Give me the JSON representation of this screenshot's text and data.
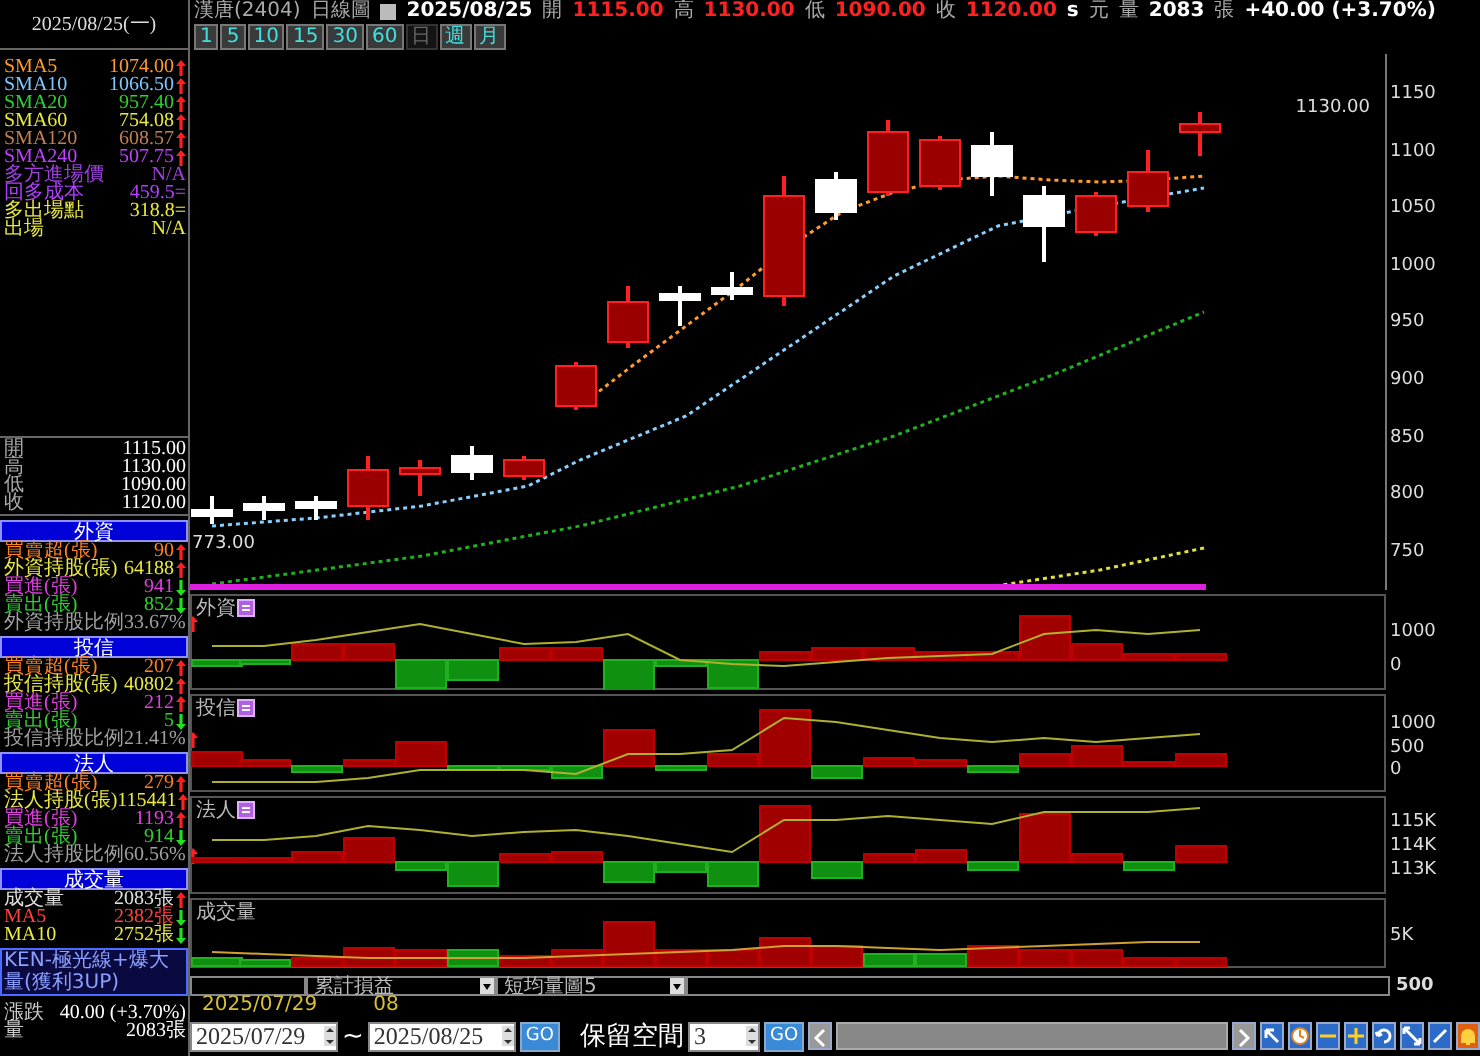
{
  "header": {
    "items": [
      {
        "text": "漢唐(2404)",
        "kind": "label"
      },
      {
        "text": "日線圖",
        "kind": "label"
      },
      {
        "text": "2025/08/25",
        "kind": "bold"
      },
      {
        "text": "開",
        "kind": "label"
      },
      {
        "text": "1115.00",
        "kind": "price"
      },
      {
        "text": "高",
        "kind": "label"
      },
      {
        "text": "1130.00",
        "kind": "price"
      },
      {
        "text": "低",
        "kind": "label"
      },
      {
        "text": "1090.00",
        "kind": "price"
      },
      {
        "text": "收",
        "kind": "label"
      },
      {
        "text": "1120.00",
        "kind": "price"
      },
      {
        "text": "s",
        "kind": "bold"
      },
      {
        "text": "元",
        "kind": "label"
      },
      {
        "text": "量",
        "kind": "label"
      },
      {
        "text": "2083",
        "kind": "bold"
      },
      {
        "text": "張",
        "kind": "label"
      },
      {
        "text": "+40.00 (+3.70%)",
        "kind": "bold"
      }
    ]
  },
  "timeframes": [
    {
      "label": "1",
      "selected": false
    },
    {
      "label": "5",
      "selected": false
    },
    {
      "label": "10",
      "selected": false
    },
    {
      "label": "15",
      "selected": false
    },
    {
      "label": "30",
      "selected": false
    },
    {
      "label": "60",
      "selected": false
    },
    {
      "label": "日",
      "selected": true
    },
    {
      "label": "週",
      "selected": false
    },
    {
      "label": "月",
      "selected": false
    }
  ],
  "sidebar": {
    "date": "2025/08/25(一)",
    "indicators": [
      {
        "label": "SMA5",
        "value": "1074.00",
        "color": "#ff9a30",
        "kind": "up"
      },
      {
        "label": "SMA10",
        "value": "1066.50",
        "color": "#7ec8ff",
        "kind": "up"
      },
      {
        "label": "SMA20",
        "value": "957.40",
        "color": "#30d030",
        "kind": "up"
      },
      {
        "label": "SMA60",
        "value": "754.08",
        "color": "#e8e840",
        "kind": "up"
      },
      {
        "label": "SMA120",
        "value": "608.57",
        "color": "#c08050",
        "kind": "up"
      },
      {
        "label": "SMA240",
        "value": "507.75",
        "color": "#c040ff",
        "kind": "up"
      },
      {
        "label": "多方進場價",
        "value": "N/A",
        "color": "#a040e0",
        "kind": "plain"
      },
      {
        "label": "回多成本",
        "value": "459.5=",
        "color": "#b040ff",
        "kind": "plain"
      },
      {
        "label": "多出場點",
        "value": "318.8=",
        "color": "#e8e840",
        "kind": "plain"
      },
      {
        "label": "出場",
        "value": "N/A",
        "color": "#e8e840",
        "kind": "plain"
      }
    ],
    "ohlc": [
      {
        "label": "開",
        "value": "1115.00"
      },
      {
        "label": "高",
        "value": "1130.00"
      },
      {
        "label": "低",
        "value": "1090.00"
      },
      {
        "label": "收",
        "value": "1120.00"
      }
    ],
    "sections": [
      {
        "title": "外資",
        "rows": [
          {
            "label": "買賣超(張)",
            "value": "90",
            "color": "#ff8020",
            "kind": "up"
          },
          {
            "label": "外資持股(張)",
            "value": "64188",
            "color": "#e8e840",
            "kind": "up"
          },
          {
            "label": "買進(張)",
            "value": "941",
            "color": "#e040e0",
            "kind": "down"
          },
          {
            "label": "賣出(張)",
            "value": "852",
            "color": "#30d030",
            "kind": "down"
          },
          {
            "label": "外資持股比例",
            "value": "33.67%",
            "color": "#a0a0a0",
            "kind": "up"
          }
        ]
      },
      {
        "title": "投信",
        "rows": [
          {
            "label": "買賣超(張)",
            "value": "207",
            "color": "#ff8020",
            "kind": "up"
          },
          {
            "label": "投信持股(張)",
            "value": "40802",
            "color": "#e8e840",
            "kind": "up"
          },
          {
            "label": "買進(張)",
            "value": "212",
            "color": "#e040e0",
            "kind": "up"
          },
          {
            "label": "賣出(張)",
            "value": "5",
            "color": "#30d030",
            "kind": "down"
          },
          {
            "label": "投信持股比例",
            "value": "21.41%",
            "color": "#a0a0a0",
            "kind": "up"
          }
        ]
      },
      {
        "title": "法人",
        "rows": [
          {
            "label": "買賣超(張)",
            "value": "279",
            "color": "#ff8020",
            "kind": "up"
          },
          {
            "label": "法人持股(張)",
            "value": "115441",
            "color": "#e8e840",
            "kind": "up"
          },
          {
            "label": "買進(張)",
            "value": "1193",
            "color": "#e040e0",
            "kind": "up"
          },
          {
            "label": "賣出(張)",
            "value": "914",
            "color": "#30d030",
            "kind": "down"
          },
          {
            "label": "法人持股比例",
            "value": "60.56%",
            "color": "#a0a0a0",
            "kind": "up"
          }
        ]
      },
      {
        "title": "成交量",
        "rows": [
          {
            "label": "成交量",
            "value": "2083張",
            "color": "#e0e0e0",
            "kind": "up"
          },
          {
            "label": "MA5",
            "value": "2382張",
            "color": "#ff4040",
            "kind": "down"
          },
          {
            "label": "MA10",
            "value": "2752張",
            "color": "#e8e840",
            "kind": "down"
          }
        ]
      }
    ],
    "strategy": "KEN-極光線+爆大量(獲利3UP)",
    "summary": [
      {
        "label": "漲跌",
        "value": "40.00 (+3.70%)"
      },
      {
        "label": "量",
        "value": "2083張"
      }
    ]
  },
  "main_chart": {
    "high_label": "1130.00",
    "low_label": "773.00",
    "yticks": [
      "1150",
      "1100",
      "1050",
      "1000",
      "950",
      "900",
      "850",
      "800",
      "750"
    ]
  },
  "panels": [
    {
      "title": "外資",
      "icon": true,
      "yticks": [
        "1000",
        "0"
      ]
    },
    {
      "title": "投信",
      "icon": true,
      "yticks": [
        "1000",
        "500",
        "0"
      ]
    },
    {
      "title": "法人",
      "icon": true,
      "yticks": [
        "115K",
        "114K",
        "113K"
      ]
    },
    {
      "title": "成交量",
      "icon": false,
      "yticks": [
        "5K"
      ]
    }
  ],
  "selectors": [
    {
      "value": "累計損益"
    },
    {
      "value": "短均量圖5"
    }
  ],
  "bottom_axis_label": "500",
  "date_labels": [
    "2025/07/29",
    "08"
  ],
  "range": {
    "from": "2025/07/29",
    "separator": "~",
    "to": "2025/08/25",
    "go": "GO",
    "keep_label": "保留空間",
    "keep_value": "3",
    "go_again": "GO"
  }
}
